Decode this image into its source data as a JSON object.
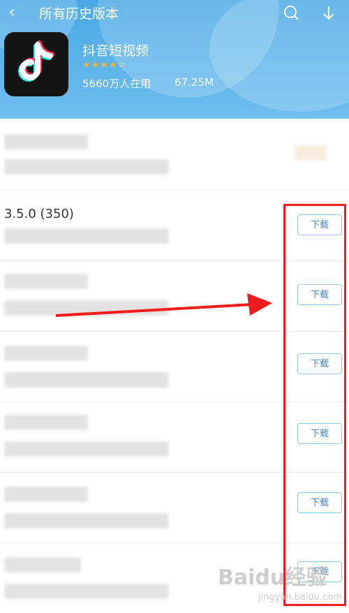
{
  "header": {
    "back_icon": "back-arrow-icon",
    "title": "所有历史版本",
    "search_icon": "search-icon",
    "download_icon": "download-icon",
    "bg_color": "#4aa8e6"
  },
  "app": {
    "name": "抖音短视频",
    "rating_stars": 4,
    "rating_max": 5,
    "users": "5660万人在用",
    "size": "67.25M",
    "icon_bg": "#141414"
  },
  "versions": [
    {
      "version": "",
      "button": ""
    },
    {
      "version": "3.5.0 (350)",
      "button": "下载"
    },
    {
      "version": "",
      "button": "下载"
    },
    {
      "version": "",
      "button": "下载"
    },
    {
      "version": "",
      "button": "下载"
    },
    {
      "version": "",
      "button": "下载"
    },
    {
      "version": "",
      "button": "下载"
    }
  ],
  "annotation": {
    "highlight_color": "#f01c1c"
  },
  "watermark": {
    "brand": "Baidu经验",
    "url": "jingyan.baidu.com"
  }
}
